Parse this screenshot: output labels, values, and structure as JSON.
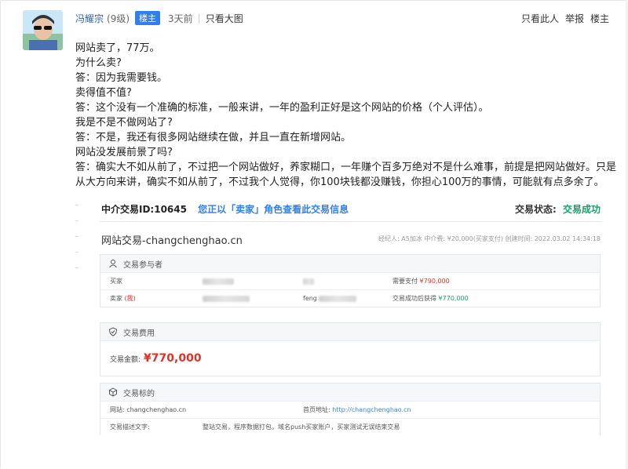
{
  "post": {
    "username": "冯耀宗",
    "level": "(9级)",
    "badge": "楼主",
    "time": "3天前",
    "separator": "|",
    "only_images": "只看大图",
    "actions": [
      "只看此人",
      "举报",
      "楼主"
    ],
    "lines": [
      "网站卖了，77万。",
      "为什么卖?",
      "答：因为我需要钱。",
      "卖得值不值?",
      "答：这个没有一个准确的标准，一般来讲，一年的盈利正好是这个网站的价格（个人评估）。",
      "我是不是不做网站了?",
      "答：不是，我还有很多网站继续在做，并且一直在新增网站。",
      "网站没发展前景了吗?",
      "答：确实大不如从前了，不过把一个网站做好，养家糊口，一年赚个百多万绝对不是什么难事，前提是把网站做好。只是从大方向来讲，确实不如从前了，不过我个人觉得，你100块钱都没赚钱，你担心100万的事情，可能就有点多余了。"
    ]
  },
  "trade": {
    "order_label": "中介交易ID:10645",
    "notice": "您正以「卖家」角色查看此交易信息",
    "status_label": "交易状态:",
    "status_value": "交易成功",
    "title": "网站交易-changchenghao.cn",
    "meta": "经纪人: A5加冰   中介费: ¥20,000(买家支付)   创建时间: 2022.03.02 14:34:18",
    "participants": {
      "heading": "交易参与者",
      "buyer_label": "买家",
      "buyer_pay_label": "需要支付",
      "buyer_pay_value": "¥790,000",
      "seller_label": "卖家",
      "seller_me": "(我)",
      "seller_name_prefix": "feng",
      "seller_get_label": "交易成功后获得",
      "seller_get_value": "¥770,000"
    },
    "fees": {
      "heading": "交易费用",
      "amount_label": "交易金额:",
      "amount_value": "¥770,000"
    },
    "target": {
      "heading": "交易标的",
      "site_label": "网站: changchenghao.cn",
      "home_label": "首页地址:",
      "home_url": "http://changchenghao.cn",
      "desc_label": "交易描述文字:",
      "desc_value": "整站交易，程序数据打包，域名push买家账户，买家测试无误结束交易"
    }
  },
  "colors": {
    "accent": "#2f80ed",
    "link": "#2d64b3",
    "price": "#e0302a",
    "success": "#11a36a"
  }
}
